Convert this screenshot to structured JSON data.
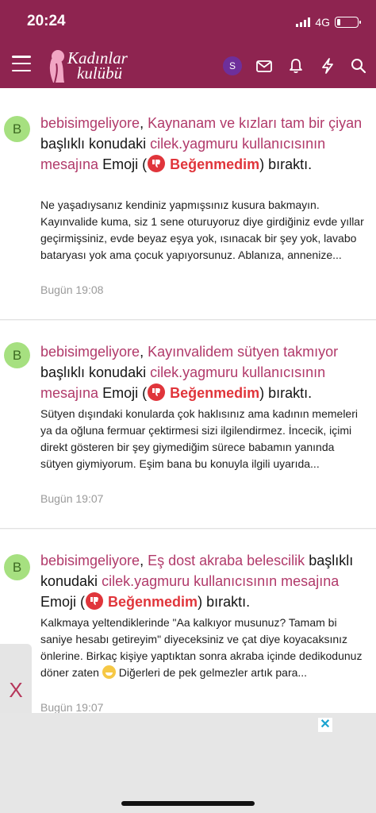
{
  "status": {
    "time": "20:24",
    "network": "4G",
    "battery_level": 0.15
  },
  "header": {
    "logo_line1": "Kadınlar",
    "logo_line2": "kulübü",
    "avatar_initial": "S",
    "brand_color": "#8e2450"
  },
  "notifications": [
    {
      "avatar_initial": "B",
      "user": "bebisimgeliyore",
      "thread": "Kaynanam ve kızları tam bir çiyan",
      "mid_text": "başlıklı konudaki",
      "target": "cilek.yagmuru kullanıcısının mesajına",
      "emoji_word": "Emoji",
      "reaction": "Beğenmedim",
      "end_text": "bıraktı.",
      "body": "Ne yaşadıysanız kendiniz yapmışsınız kusura bakmayın. Kayınvalide kuma, siz 1 sene oturuyoruz diye girdiğiniz evde yıllar geçirmişsiniz, evde beyaz eşya yok, ısınacak bir şey yok, lavabo bataryası yok ama çocuk yapıyorsunuz. Ablanıza, annenize...",
      "time": "Bugün 19:08"
    },
    {
      "avatar_initial": "B",
      "user": "bebisimgeliyore",
      "thread": "Kayınvalidem sütyen takmıyor",
      "mid_text": "başlıklı konudaki",
      "target": "cilek.yagmuru kullanıcısının mesajına",
      "emoji_word": "Emoji",
      "reaction": "Beğenmedim",
      "end_text": "bıraktı.",
      "body": "Sütyen dışındaki konularda çok haklısınız ama kadının memeleri ya da oğluna fermuar çektirmesi sizi ilgilendirmez. İncecik, içimi direkt gösteren bir şey giymediğim sürece babamın yanında sütyen giymiyorum. Eşim bana bu konuyla ilgili uyarıda...",
      "time": "Bugün 19:07"
    },
    {
      "avatar_initial": "B",
      "user": "bebisimgeliyore",
      "thread": "Eş dost akraba belescilik",
      "mid_text": "başlıklı konudaki",
      "target": "cilek.yagmuru kullanıcısının mesajına",
      "emoji_word": "Emoji",
      "reaction": "Beğenmedim",
      "end_text": "bıraktı.",
      "body_part1": "Kalkmaya yeltendiklerinde \"Aa kalkıyor musunuz? Tamam bi saniye hesabı getireyim\" diyeceksiniz ve çat diye koyacaksınız önlerine. Birkaç kişiye yaptıktan sonra akraba içinde dedikodunuz döner zaten",
      "body_part2": "Diğerleri de pek gelmezler artık para...",
      "time": "Bugün 19:07"
    }
  ],
  "side_tab": {
    "label": "X"
  },
  "ad": {
    "close_label": "✕"
  }
}
